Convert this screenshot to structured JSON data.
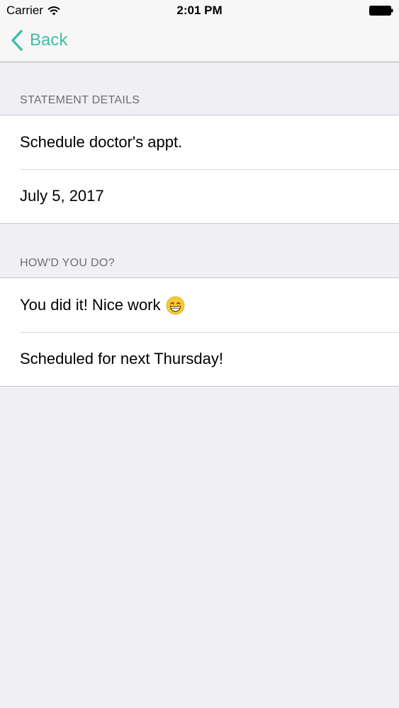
{
  "status_bar": {
    "carrier": "Carrier",
    "time": "2:01 PM",
    "icons": [
      "wifi-icon",
      "battery-icon"
    ]
  },
  "nav": {
    "back_label": "Back",
    "accent_color": "#3fbea7"
  },
  "sections": [
    {
      "header": "STATEMENT DETAILS",
      "rows": [
        "Schedule doctor's appt.",
        "July 5, 2017"
      ]
    },
    {
      "header": "HOW'D YOU DO?",
      "rows": [
        "You did it! Nice work",
        "Scheduled for next Thursday!"
      ],
      "emoji_icon": "grinning-face-icon"
    }
  ]
}
